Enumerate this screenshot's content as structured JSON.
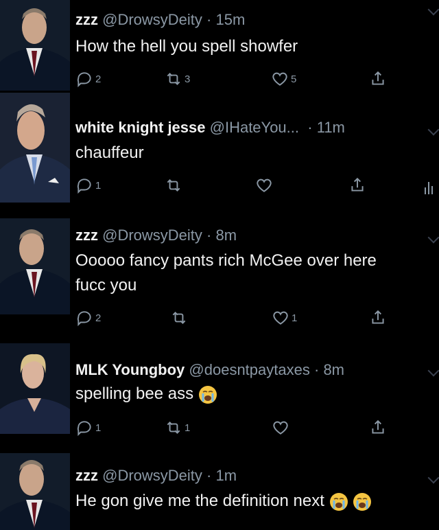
{
  "tweets": [
    {
      "name": "zzz",
      "handle": "@DrowsyDeity",
      "time": "15m",
      "text": "How the hell you spell showfer",
      "text2": "",
      "reply": "2",
      "retweet": "3",
      "like": "5",
      "emoji_count": 0
    },
    {
      "name": "white knight jesse",
      "handle": "@IHateYou...",
      "time": "11m",
      "text": "chauffeur",
      "text2": "",
      "reply": "1",
      "retweet": "",
      "like": "",
      "emoji_count": 0
    },
    {
      "name": "zzz",
      "handle": "@DrowsyDeity",
      "time": "8m",
      "text": "Ooooo fancy pants rich McGee over here",
      "text2": "fucc you",
      "reply": "2",
      "retweet": "",
      "like": "1",
      "emoji_count": 0
    },
    {
      "name": "MLK Youngboy",
      "handle": "@doesntpaytaxes",
      "time": "8m",
      "text": "spelling bee ass",
      "text2": "",
      "reply": "1",
      "retweet": "1",
      "like": "",
      "emoji_count": 1
    },
    {
      "name": "zzz",
      "handle": "@DrowsyDeity",
      "time": "1m",
      "text": "He gon give me the definition next",
      "text2": "",
      "reply": "",
      "retweet": "",
      "like": "",
      "emoji_count": 2
    }
  ],
  "icons": {
    "reply": "reply-icon",
    "retweet": "retweet-icon",
    "like": "heart-icon",
    "share": "share-icon",
    "emoji": "loudly-crying-face-emoji"
  },
  "colors": {
    "background": "#000000",
    "text": "#f2f2f2",
    "secondary": "#8b98a5"
  }
}
